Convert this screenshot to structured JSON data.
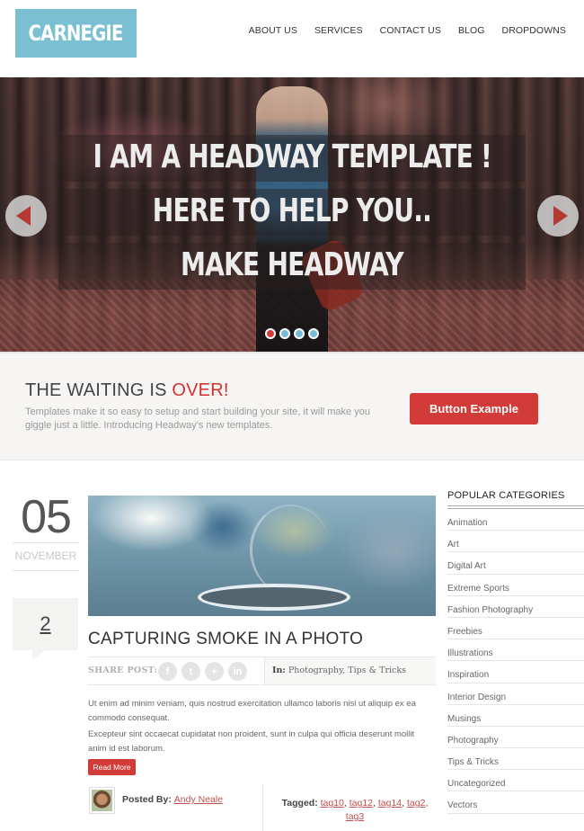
{
  "header": {
    "logo_text": "CARNEGIE",
    "logo_color": "#7bbfd2",
    "nav": [
      "ABOUT US",
      "SERVICES",
      "CONTACT US",
      "BLOG",
      "DROPDOWNS"
    ]
  },
  "slider": {
    "lines": [
      "I AM A HEADWAY TEMPLATE !",
      "HERE TO HELP YOU..",
      "MAKE HEADWAY"
    ],
    "prev_icon": "arrow-left-icon",
    "next_icon": "arrow-right-icon",
    "slide_count": 4,
    "active_slide": 1
  },
  "cta": {
    "title_prefix": "THE WAITING IS ",
    "title_accent": "OVER!",
    "text": "Templates make it so easy to setup and start building your site, it will make you giggle just a little. Introducing Headway's new templates.",
    "button_label": "Button Example",
    "accent_color": "#d23b38"
  },
  "post": {
    "day": "05",
    "month": "NOVEMBER",
    "comment_count": "2",
    "title": "CAPTURING SMOKE IN A PHOTO",
    "share_label": "SHARE POST:",
    "share_icons": [
      {
        "name": "facebook-icon",
        "glyph": "f"
      },
      {
        "name": "twitter-icon",
        "glyph": "t"
      },
      {
        "name": "google-plus-icon",
        "glyph": "+"
      },
      {
        "name": "linkedin-icon",
        "glyph": "in"
      }
    ],
    "in_label": "In:",
    "categories": [
      "Photography",
      "Tips & Tricks"
    ],
    "paragraphs": [
      "Ut enim ad minim veniam, quis nostrud exercitation ullamco laboris nisi ut aliquip ex ea commodo consequat.",
      "Excepteur sint occaecat cupidatat non proident, sunt in culpa qui officia deserunt mollit anim id est laborum."
    ],
    "read_more_label": "Read More",
    "posted_by_label": "Posted By:",
    "author": "Andy Neale",
    "tagged_label": "Tagged:",
    "tags": [
      "tag10",
      "tag12",
      "tag14",
      "tag2",
      "tag3"
    ]
  },
  "sidebar": {
    "title": "POPULAR CATEGORIES",
    "categories": [
      "Animation",
      "Art",
      "Digital Art",
      "Extreme Sports",
      "Fashion Photography",
      "Freebies",
      "Illustrations",
      "Inspiration",
      "Interior Design",
      "Musings",
      "Photography",
      "Tips & Tricks",
      "Uncategorized",
      "Vectors"
    ]
  }
}
